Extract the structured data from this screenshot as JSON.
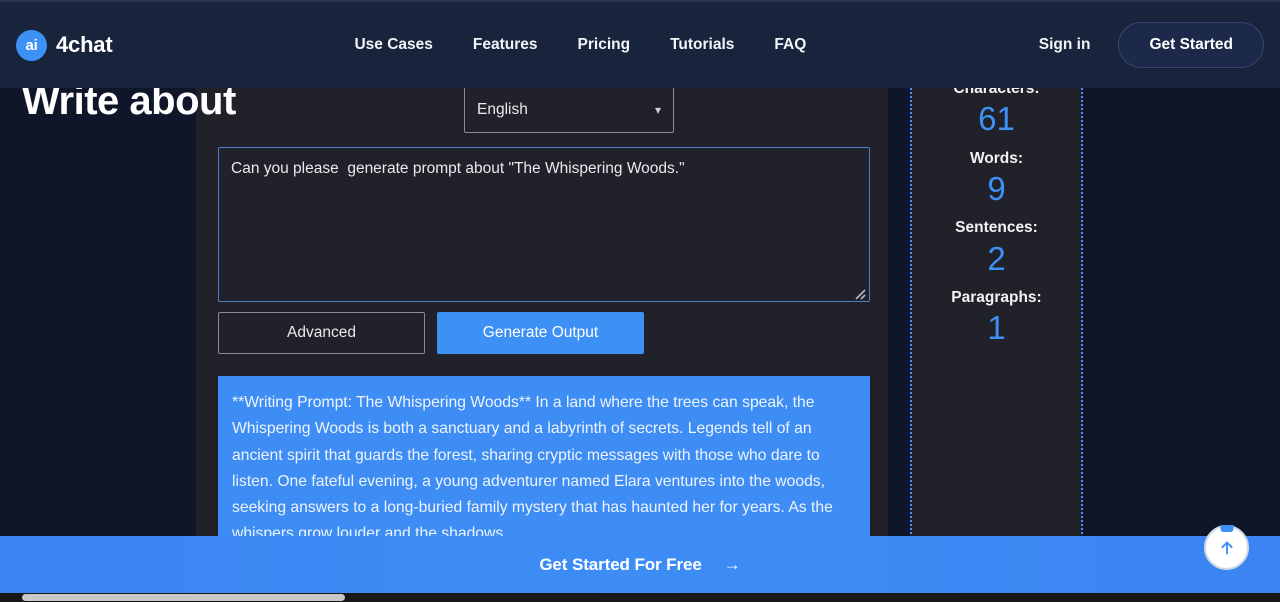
{
  "header": {
    "logo_badge": "ai",
    "logo_text": "4chat",
    "nav": [
      {
        "label": "Use Cases",
        "name": "nav-use-cases"
      },
      {
        "label": "Features",
        "name": "nav-features"
      },
      {
        "label": "Pricing",
        "name": "nav-pricing"
      },
      {
        "label": "Tutorials",
        "name": "nav-tutorials"
      },
      {
        "label": "FAQ",
        "name": "nav-faq"
      }
    ],
    "signin_label": "Sign in",
    "get_started_label": "Get Started"
  },
  "tool": {
    "title": "Write about",
    "language_selected": "English",
    "language_options": [
      "English"
    ],
    "chevron_icon": "chevron-down-icon",
    "prompt_value": "Can you please  generate prompt about \"The Whispering Woods.\"",
    "prompt_placeholder": "",
    "advanced_label": "Advanced",
    "generate_label": "Generate Output",
    "output_text": "**Writing Prompt: The Whispering Woods** In a land where the trees can speak, the Whispering Woods is both a sanctuary and a labyrinth of secrets. Legends tell of an ancient spirit that guards the forest, sharing cryptic messages with those who dare to listen. One fateful evening, a young adventurer named Elara ventures into the woods, seeking answers to a long-buried family mystery that has haunted her for years. As the whispers grow louder and the shadows"
  },
  "stats": [
    {
      "label": "Characters:",
      "value": "61"
    },
    {
      "label": "Words:",
      "value": "9"
    },
    {
      "label": "Sentences:",
      "value": "2"
    },
    {
      "label": "Paragraphs:",
      "value": "1"
    }
  ],
  "cta": {
    "text": "Get Started For Free",
    "arrow": "→"
  },
  "scroll_top": {
    "icon": "arrow-up-icon"
  },
  "colors": {
    "accent": "#3d91f5",
    "header_bg": "#18233c",
    "panel_bg": "#212129",
    "page_bg": "#0f1629",
    "output_bg": "#3d8df5"
  }
}
